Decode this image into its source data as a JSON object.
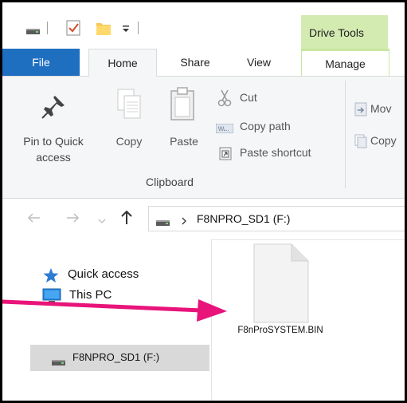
{
  "window": {
    "drive_tools_label": "Drive Tools"
  },
  "tabs": {
    "file": "File",
    "home": "Home",
    "share": "Share",
    "view": "View",
    "manage": "Manage"
  },
  "ribbon": {
    "pin_label_line1": "Pin to Quick",
    "pin_label_line2": "access",
    "copy_label": "Copy",
    "paste_label": "Paste",
    "cut_label": "Cut",
    "copy_path_label": "Copy path",
    "paste_shortcut_label": "Paste shortcut",
    "clipboard_group": "Clipboard",
    "move_to_partial": "Mov",
    "copy_to_partial": "Copy"
  },
  "address": {
    "crumb": "F8NPRO_SD1 (F:)"
  },
  "nav": {
    "quick_access": "Quick access",
    "this_pc": "This PC",
    "drive": "F8NPRO_SD1 (F:)"
  },
  "content": {
    "file_name": "F8nProSYSTEM.BIN"
  },
  "colors": {
    "file_tab": "#1f6fc1",
    "drive_tools_bg": "#d3ebb1",
    "arrow": "#e8147a",
    "selection": "#d9d9d9"
  }
}
